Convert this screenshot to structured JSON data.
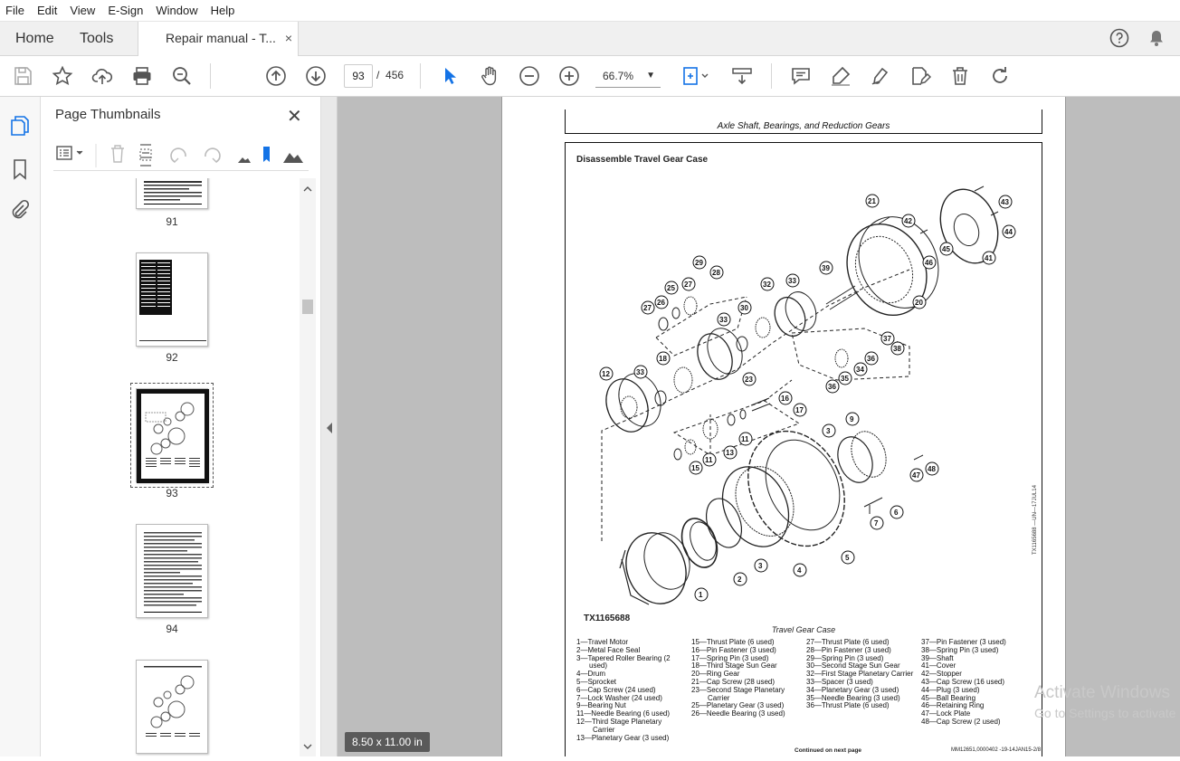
{
  "menu": {
    "items": [
      "File",
      "Edit",
      "View",
      "E-Sign",
      "Window",
      "Help"
    ]
  },
  "tabs": {
    "home": "Home",
    "tools": "Tools",
    "document": "Repair manual - T...",
    "close": "×"
  },
  "toolbar": {
    "current_page": "93",
    "separator": "/",
    "total_pages": "456",
    "zoom": "66.7%"
  },
  "sidebar": {
    "title": "Page Thumbnails",
    "thumbnails": [
      {
        "label": "91"
      },
      {
        "label": "92"
      },
      {
        "label": "93",
        "selected": true
      },
      {
        "label": "94"
      },
      {
        "label": ""
      }
    ]
  },
  "viewer": {
    "page_size": "8.50 x 11.00 in"
  },
  "document": {
    "header": "Axle Shaft, Bearings, and Reduction Gears",
    "section_title": "Disassemble Travel Gear Case",
    "figure_id": "TX1165688",
    "figure_caption": "Travel Gear Case",
    "vertical_code": "TX1165688 —UN—17JUL14",
    "diagram_callouts": [
      "1",
      "2",
      "3",
      "4",
      "5",
      "6",
      "7",
      "9",
      "11",
      "12",
      "13",
      "15",
      "16",
      "17",
      "18",
      "20",
      "21",
      "23",
      "25",
      "26",
      "27",
      "28",
      "29",
      "30",
      "32",
      "33",
      "34",
      "35",
      "36",
      "37",
      "38",
      "39",
      "41",
      "42",
      "43",
      "44",
      "45",
      "46",
      "47",
      "48"
    ],
    "legend_col1": [
      "1—Travel Motor",
      "2—Metal Face Seal",
      "3—Tapered Roller Bearing (2",
      "used)",
      "4—Drum",
      "5—Sprocket",
      "6—Cap Screw (24 used)",
      "7—Lock Washer (24 used)",
      "9—Bearing Nut",
      "11—Needle Bearing (6 used)",
      "12—Third Stage Planetary",
      "Carrier",
      "13—Planetary Gear (3 used)"
    ],
    "legend_col2": [
      "15—Thrust Plate (6 used)",
      "16—Pin Fastener (3 used)",
      "17—Spring Pin (3 used)",
      "18—Third Stage Sun Gear",
      "20—Ring Gear",
      "21—Cap Screw (28 used)",
      "23—Second Stage Planetary",
      "Carrier",
      "25—Planetary Gear (3 used)",
      "26—Needle Bearing (3 used)"
    ],
    "legend_col3": [
      "27—Thrust Plate (6 used)",
      "28—Pin Fastener (3 used)",
      "29—Spring Pin (3 used)",
      "30—Second Stage Sun Gear",
      "32—First Stage Planetary Carrier",
      "33—Spacer (3 used)",
      "34—Planetary Gear (3 used)",
      "35—Needle Bearing (3 used)",
      "36—Thrust Plate (6 used)"
    ],
    "legend_col4": [
      "37—Pin Fastener (3 used)",
      "38—Spring Pin (3 used)",
      "39—Shaft",
      "41—Cover",
      "42—Stopper",
      "43—Cap Screw (16 used)",
      "44—Plug (3 used)",
      "45—Ball Bearing",
      "46—Retaining Ring",
      "47—Lock Plate",
      "48—Cap Screw (2 used)"
    ],
    "continued": "Continued on next page",
    "doc_id": "MM12651,0000402 -19-14JAN15-2/8"
  },
  "watermark": {
    "line1": "Activate Windows",
    "line2": "Go to Settings to activate"
  }
}
